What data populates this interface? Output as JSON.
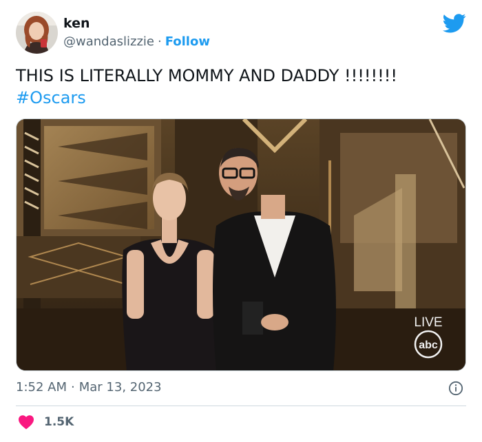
{
  "tweet": {
    "author": {
      "name": "ken",
      "handle": "@wandaslizzie",
      "separator": "·",
      "follow_label": "Follow",
      "avatar_icon": "user-avatar-icon"
    },
    "platform_icon": "twitter-bird-icon",
    "text": "THIS IS LITERALLY MOMMY AND DADDY !!!!!!!!",
    "hashtag": "#Oscars",
    "media": {
      "live_label": "LIVE",
      "network_logo": "abc"
    },
    "time": "1:52 AM",
    "date_separator": "·",
    "date": "Mar 13, 2023",
    "info_icon": "info-icon",
    "likes": {
      "icon": "heart-icon",
      "count": "1.5K"
    }
  },
  "colors": {
    "accent": "#1d9bf0",
    "text_primary": "#0f1419",
    "text_secondary": "#536471",
    "heart": "#f91880",
    "divider": "#cfd9de"
  }
}
